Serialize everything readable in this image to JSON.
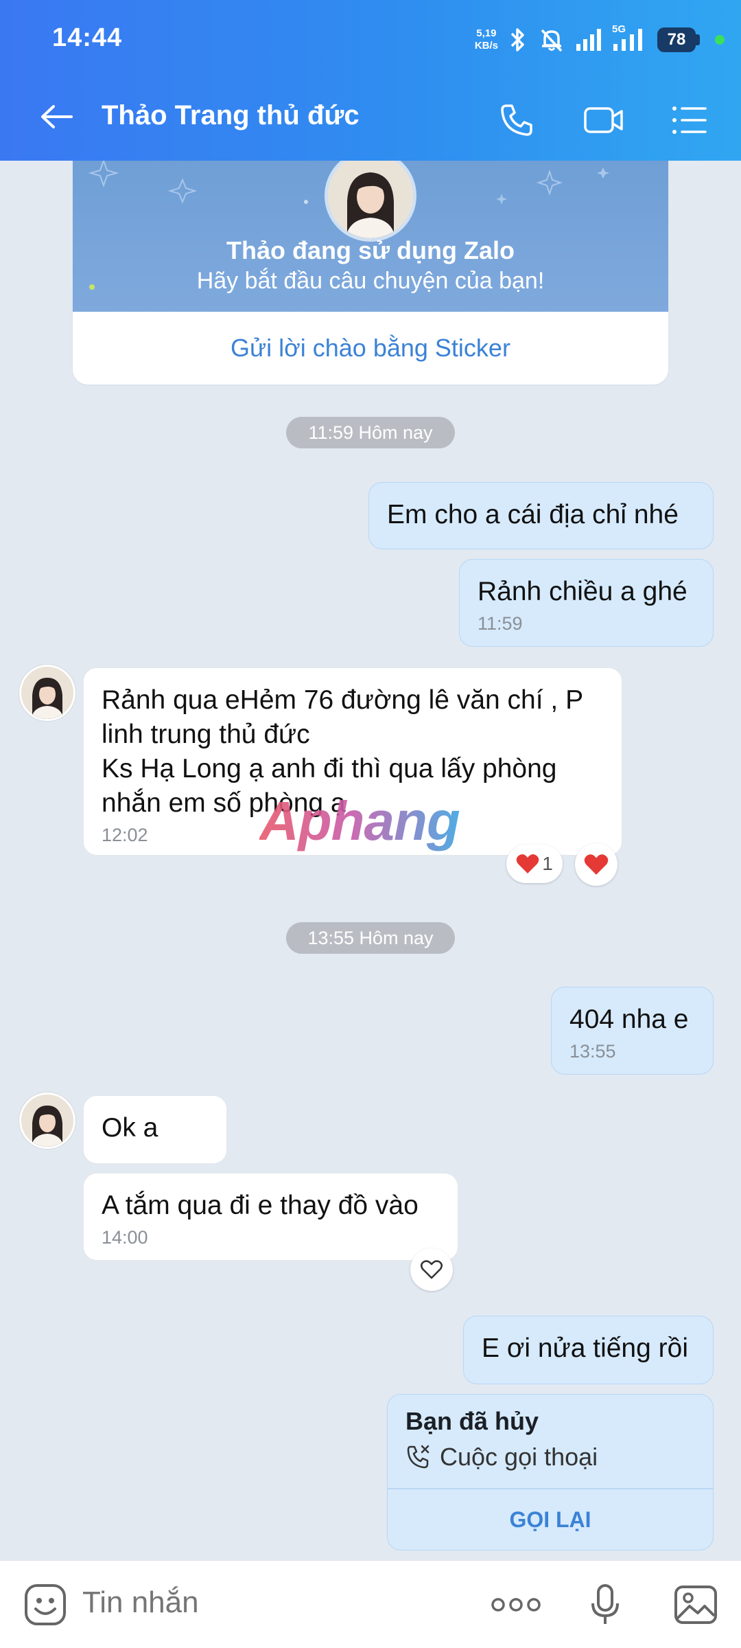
{
  "status_bar": {
    "time": "14:44",
    "net_speed_value": "5,19",
    "net_speed_unit": "KB/s",
    "network_label": "5G",
    "battery": "78"
  },
  "header": {
    "title": "Thảo Trang thủ đức"
  },
  "banner": {
    "title": "Thảo đang sử dụng Zalo",
    "subtitle": "Hãy bắt đầu câu chuyện của bạn!",
    "action": "Gửi lời chào bằng Sticker"
  },
  "chips": {
    "first": "11:59 Hôm nay",
    "second": "13:55 Hôm nay"
  },
  "messages": {
    "m1": {
      "text": "Em cho a cái địa chỉ nhé"
    },
    "m2": {
      "text": "Rảnh chiều a ghé",
      "time": "11:59"
    },
    "m3": {
      "lines": [
        "Rảnh qua eHẻm 76 đường lê văn chí , P",
        "linh trung thủ đức",
        "Ks Hạ Long ạ anh đi thì qua lấy phòng",
        "nhắn em số phòng ạ"
      ],
      "time": "12:02",
      "reaction_count": "1"
    },
    "m4": {
      "text": "404 nha e",
      "time": "13:55"
    },
    "m5": {
      "text": "Ok a"
    },
    "m6": {
      "text": "A tắm qua đi e thay đồ vào",
      "time": "14:00"
    },
    "m7": {
      "text": "E ơi nửa tiếng rồi"
    }
  },
  "call_card": {
    "title": "Bạn đã hủy",
    "subtitle": "Cuộc gọi thoại",
    "action": "GỌI LẠI"
  },
  "watermark": "Aphang",
  "input": {
    "placeholder": "Tin nhắn"
  },
  "colors": {
    "header_start": "#3a78f2",
    "header_end": "#30a6f1",
    "outgoing_bubble": "#d6eafc",
    "incoming_bubble": "#ffffff",
    "accent": "#3b82d6",
    "heart": "#e53935"
  }
}
